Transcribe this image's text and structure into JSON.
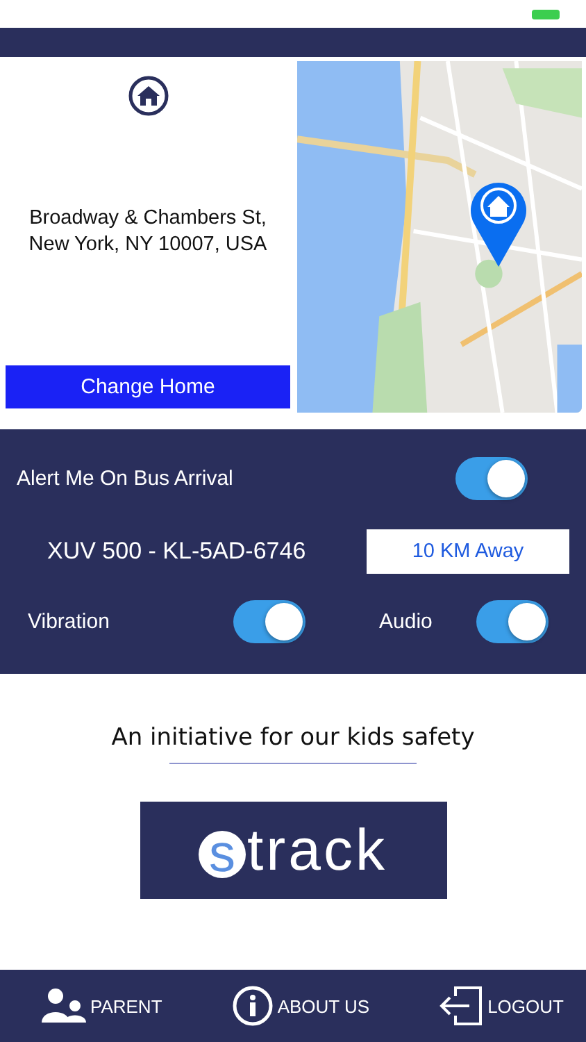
{
  "home": {
    "address": "Broadway & Chambers St,\nNew York, NY 10007, USA",
    "button": "Change Home"
  },
  "alerts": {
    "main": {
      "label": "Alert Me On Bus Arrival",
      "on": true
    },
    "vehicle": "XUV 500 - KL-5AD-6746",
    "distance": "10 KM Away",
    "options": [
      {
        "label": "Vibration",
        "on": true
      },
      {
        "label": "Audio",
        "on": true
      }
    ]
  },
  "tagline": "An initiative for our kids safety",
  "logo": {
    "mark": "s",
    "text": "track"
  },
  "nav": [
    {
      "kind": "parent",
      "label": "PARENT"
    },
    {
      "kind": "info",
      "label": "ABOUT US"
    },
    {
      "kind": "logout",
      "label": "LOGOUT"
    }
  ]
}
